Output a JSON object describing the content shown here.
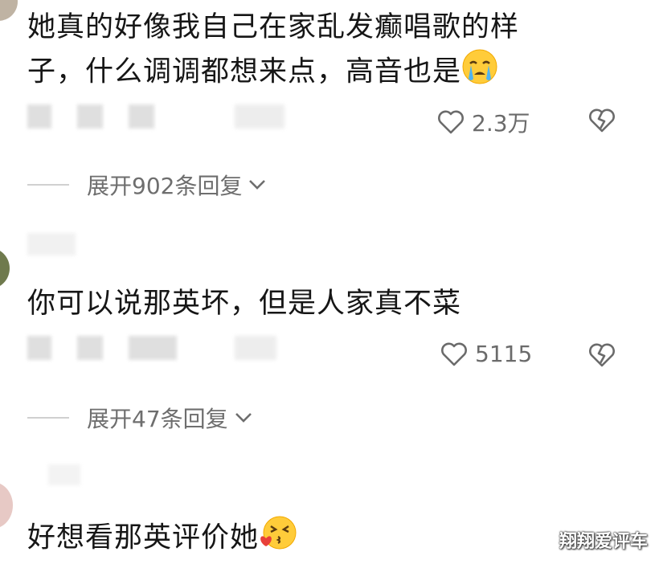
{
  "comments": [
    {
      "text_line1": "她真的好像我自己在家乱发癫唱歌的样",
      "text_line2": "子，什么调调都想来点，高音也是",
      "emoji": "crying-face",
      "likes": "2.3万",
      "expand": "展开902条回复"
    },
    {
      "text": "你可以说那英坏，但是人家真不菜",
      "likes": "5115",
      "expand": "展开47条回复"
    },
    {
      "text": "好想看那英评价她",
      "emoji": "kissing-face"
    }
  ],
  "watermark": "翔翔爱评车",
  "colors": {
    "text": "#161616",
    "meta": "#6b6b6b",
    "line": "#d0d0d0",
    "emoji": "#ffcc3a"
  }
}
